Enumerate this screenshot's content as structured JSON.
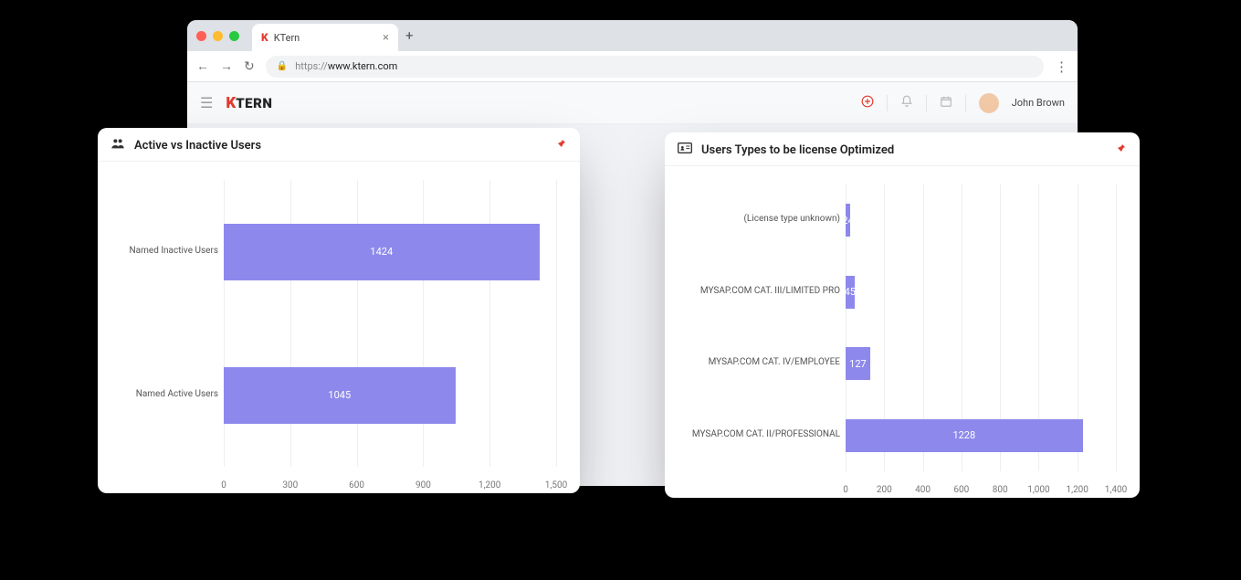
{
  "browser": {
    "tab_title": "KTern",
    "url_prefix": "https://",
    "url_host": "www.ktern.com"
  },
  "header": {
    "logo_k": "K",
    "logo_tern": "TERN",
    "user_name": "John Brown"
  },
  "panels": {
    "left": {
      "title": "Active vs Inactive Users"
    },
    "right": {
      "title": "Users Types to be license Optimized"
    }
  },
  "chart_data": [
    {
      "type": "bar",
      "orientation": "horizontal",
      "title": "Active vs Inactive Users",
      "categories": [
        "Named Inactive Users",
        "Named Active Users"
      ],
      "values": [
        1424,
        1045
      ],
      "xlim": [
        0,
        1500
      ],
      "xticks": [
        0,
        300,
        600,
        900,
        1200,
        1500
      ],
      "xlabel": "",
      "ylabel": ""
    },
    {
      "type": "bar",
      "orientation": "horizontal",
      "title": "Users Types to be license Optimized",
      "categories": [
        "(License type unknown)",
        "MYSAP.COM CAT. III/LIMITED PRO",
        "MYSAP.COM CAT. IV/EMPLOYEE",
        "MYSAP.COM CAT. II/PROFESSIONAL"
      ],
      "values": [
        24,
        45,
        127,
        1228
      ],
      "xlim": [
        0,
        1400
      ],
      "xticks": [
        0,
        200,
        400,
        600,
        800,
        1000,
        1200,
        1400
      ],
      "xlabel": "",
      "ylabel": ""
    }
  ]
}
